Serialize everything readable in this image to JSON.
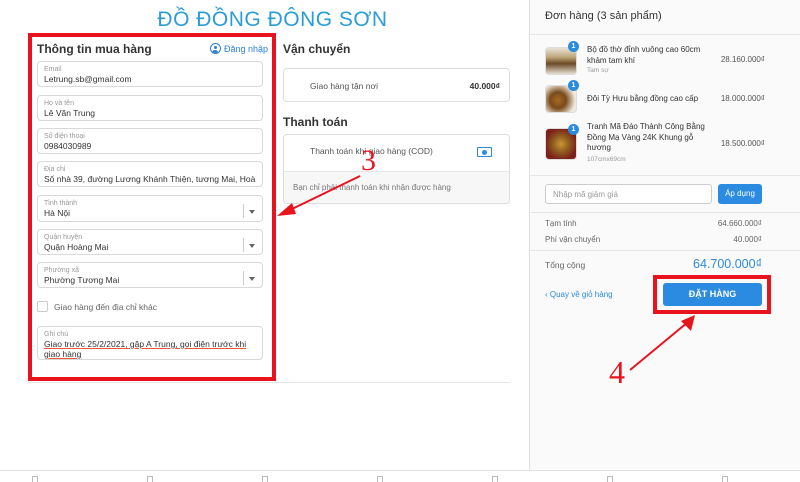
{
  "store": {
    "name": "ĐỒ ĐỒNG ĐÔNG SƠN"
  },
  "buyer": {
    "heading": "Thông tin mua hàng",
    "login_label": "Đăng nhập",
    "email": {
      "label": "Email",
      "value": "Letrung.sb@gmail.com"
    },
    "name": {
      "label": "Họ và tên",
      "value": "Lê Văn Trung"
    },
    "phone": {
      "label": "Số điện thoại",
      "value": "0984030989"
    },
    "address": {
      "label": "Địa chỉ",
      "value": "Số nhà 39, đường Lương Khánh Thiện, tương Mai, Hoàng Mai"
    },
    "province": {
      "label": "Tỉnh thành",
      "value": "Hà Nội"
    },
    "district": {
      "label": "Quận huyện",
      "value": "Quận Hoàng Mai"
    },
    "ward": {
      "label": "Phường xã",
      "value": "Phường Tương Mai"
    },
    "other_address_label": "Giao hàng đến địa chỉ khác",
    "note": {
      "label": "Ghi chú",
      "value": "Giao trước 25/2/2021, gặp A Trung, gọi điện trước khi giao hàng"
    }
  },
  "shipping": {
    "heading": "Vận chuyển",
    "option_label": "Giao hàng tận nơi",
    "option_price": "40.000₫"
  },
  "payment": {
    "heading": "Thanh toán",
    "option_label": "Thanh toán khi giao hàng (COD)",
    "description": "Bạn chỉ phải thanh toán khi nhận được hàng"
  },
  "order": {
    "heading": "Đơn hàng (3 sản phẩm)",
    "items": [
      {
        "qty": "1",
        "name": "Bộ đồ thờ đỉnh vuông cao 60cm khảm tam khí",
        "variant": "Tam sự",
        "price": "28.160.000₫"
      },
      {
        "qty": "1",
        "name": "Đôi Tỳ Hưu bằng đồng cao cấp",
        "variant": "",
        "price": "18.000.000₫"
      },
      {
        "qty": "1",
        "name": "Tranh Mã Đáo Thành Công Bằng Đồng Mạ Vàng 24K Khung gỗ hương",
        "variant": "107cmx69cm",
        "price": "18.500.000₫"
      }
    ],
    "discount_placeholder": "Nhập mã giảm giá",
    "apply_label": "Áp dụng",
    "subtotal_label": "Tạm tính",
    "subtotal_value": "64.660.000₫",
    "shipping_label": "Phí vận chuyển",
    "shipping_value": "40.000₫",
    "total_label": "Tổng cộng",
    "total_value": "64.700.000₫",
    "back_label": "‹ Quay về giỏ hàng",
    "place_order_label": "ĐẶT HÀNG"
  },
  "annotations": {
    "step3": "3",
    "step4": "4"
  },
  "colors": {
    "accent": "#2a8be0",
    "annotation": "#e8131d",
    "title": "#2a9dd8"
  },
  "icons": {
    "login": "user-icon",
    "payment": "cash-icon",
    "select": "chevron-down-icon"
  }
}
